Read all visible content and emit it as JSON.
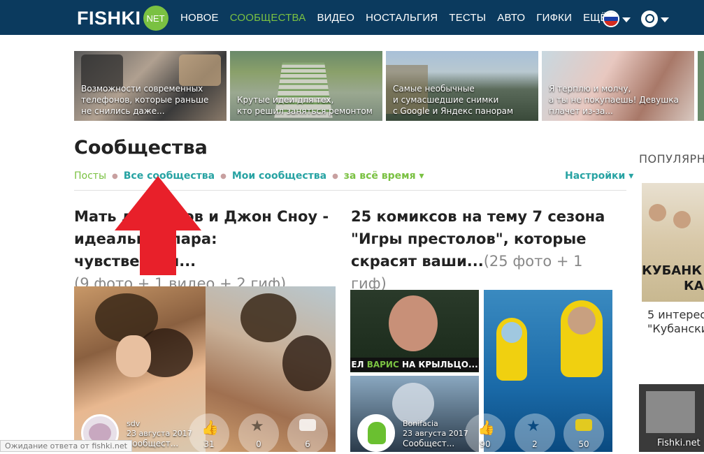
{
  "header": {
    "logo_text": "FISHKI",
    "logo_badge": "NET",
    "nav": [
      "НОВОЕ",
      "СООБЩЕСТВА",
      "ВИДЕО",
      "НОСТАЛЬГИЯ",
      "ТЕСТЫ",
      "АВТО",
      "ГИФКИ",
      "ЕЩЁ"
    ],
    "active_nav": "СООБЩЕСТВА",
    "icons": [
      "russia-flag-icon",
      "search-icon"
    ]
  },
  "teasers": [
    {
      "caption": "Возможности современных\nтелефонов, которые раньше\nне снились даже..."
    },
    {
      "caption": "Крутые идеи для тех,\nкто решил заняться ремонтом"
    },
    {
      "caption": "Самые необычные\nи сумасшедшие снимки\nс Google и Яндекс панорам"
    },
    {
      "caption": "Я терплю и молчу,\nа ты не покупаешь! Девушка\nплачет из-за..."
    }
  ],
  "page_title": "Сообщества",
  "filters": {
    "posts": "Посты",
    "all": "Все сообщества",
    "mine": "Мои сообщества",
    "time": "за всё время ▾",
    "settings": "Настройки ▾"
  },
  "posts": [
    {
      "title_line1": "Мать драконов и Джон Сноу -",
      "title_line2": "идеальная пара: чувственная...",
      "meta": "(9 фото + 1 видео + 2 гиф)",
      "author": "sdv",
      "date": "23 августа 2017",
      "community": "Сообщест...",
      "likes": "31",
      "stars": "0",
      "comments": "6"
    },
    {
      "title_line1": "25 комиксов на тему 7 сезона",
      "title_line2": "\"Игры престолов\", которые",
      "title_line3": "скрасят ваши...",
      "meta": "(25 фото + 1 гиф)",
      "author": "Bonifacia",
      "date": "23 августа 2017",
      "community": "Сообщест...",
      "likes": "90",
      "stars": "2",
      "comments": "50",
      "comic_caption_1": "ЕЛ ",
      "comic_caption_2": "ВАРИС",
      "comic_caption_3": " НА КРЫЛЬЦО..."
    }
  ],
  "sidebar": {
    "title": "ПОПУЛЯРНО",
    "item_line1": "5 интерес",
    "item_line2": "\"Кубански",
    "img_text_1": "КУБАНК",
    "img_text_2": "КА"
  },
  "status_text": "Ожидание ответа от fishki.net",
  "watermark": "Fishki.net"
}
